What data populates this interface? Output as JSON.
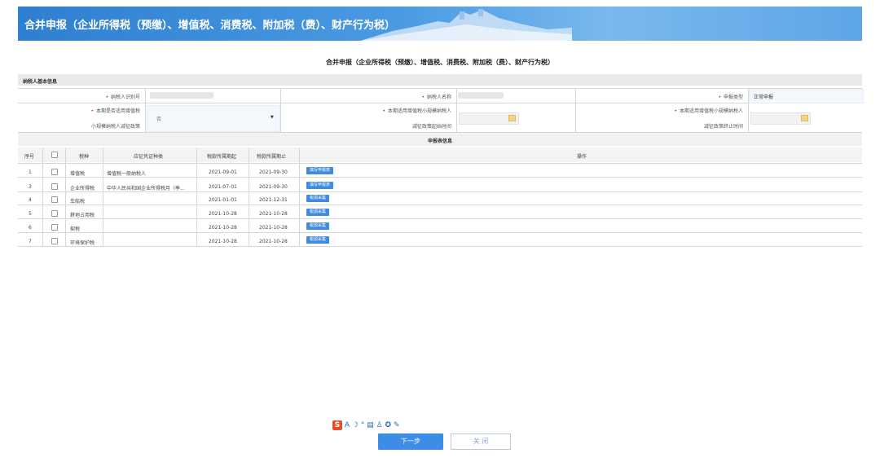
{
  "banner": {
    "title": "合并申报（企业所得税（预缴）、增值税、消费税、附加税（费）、财产行为税）"
  },
  "page_title": "合并申报（企业所得税（预缴）、增值税、消费税、附加税（费）、财产行为税）",
  "basic_info": {
    "section_title": "纳税人基本信息",
    "required_mark": "•",
    "taxpayer_id_label": "纳税人识别号",
    "taxpayer_name_label": "纳税人名称",
    "declare_type_label": "申报类型",
    "declare_type_value": "正常申报",
    "small_scale_label_line1": "本期是否适用增值税",
    "small_scale_label_line2": "小规模纳税人减征政策",
    "small_scale_value": "否",
    "start_time_label_line1": "本期适用增值税小规模纳税人",
    "start_time_label_line2": "减征政策起始时间",
    "end_time_label_line1": "本期适用增值税小规模纳税人",
    "end_time_label_line2": "减征政策终止时间"
  },
  "declare_info": {
    "section_title": "申报表信息",
    "headers": {
      "seq": "序号",
      "tax_type": "税种",
      "voucher_type": "应征凭证种类",
      "period_start": "税款所属期起",
      "period_end": "税款所属期止",
      "operation": "操作"
    },
    "rows": [
      {
        "seq": "1",
        "tax_type": "增值税",
        "voucher_type": "增值税一般纳税人",
        "period_start": "2021-09-01",
        "period_end": "2021-09-30",
        "action": "填写申报表"
      },
      {
        "seq": "3",
        "tax_type": "企业所得税",
        "voucher_type": "中华人民共和国企业所得税月（季...",
        "period_start": "2021-07-01",
        "period_end": "2021-09-30",
        "action": "填写申报表"
      },
      {
        "seq": "4",
        "tax_type": "车船税",
        "voucher_type": "",
        "period_start": "2021-01-01",
        "period_end": "2021-12-31",
        "action": "税源采集"
      },
      {
        "seq": "5",
        "tax_type": "耕地占用税",
        "voucher_type": "",
        "period_start": "2021-10-28",
        "period_end": "2021-10-28",
        "action": "税源采集"
      },
      {
        "seq": "6",
        "tax_type": "契税",
        "voucher_type": "",
        "period_start": "2021-10-28",
        "period_end": "2021-10-28",
        "action": "税源采集"
      },
      {
        "seq": "7",
        "tax_type": "环境保护税",
        "voucher_type": "",
        "period_start": "2021-10-28",
        "period_end": "2021-10-28",
        "action": "税源采集"
      }
    ]
  },
  "ime_toolbar": {
    "logo": "S",
    "icons_text": "A ☽ ° ▤ ♙ ✪ ✎"
  },
  "footer": {
    "next_label": "下一步",
    "close_label": "关 闭"
  }
}
